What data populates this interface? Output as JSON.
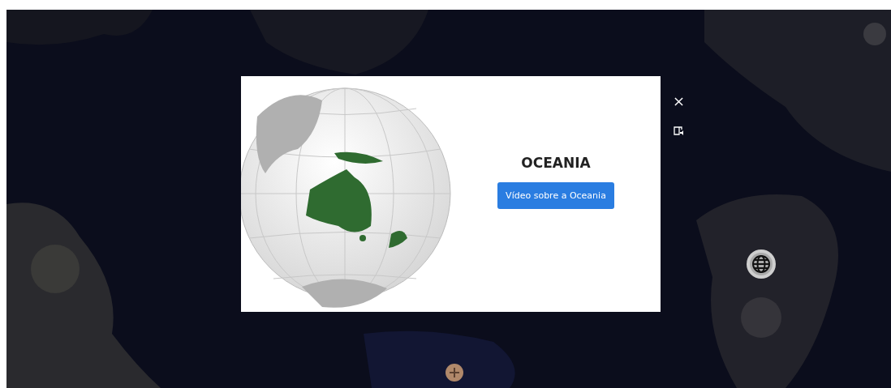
{
  "modal": {
    "title": "OCEANIA",
    "video_button": "Vídeo sobre a Oceania"
  }
}
